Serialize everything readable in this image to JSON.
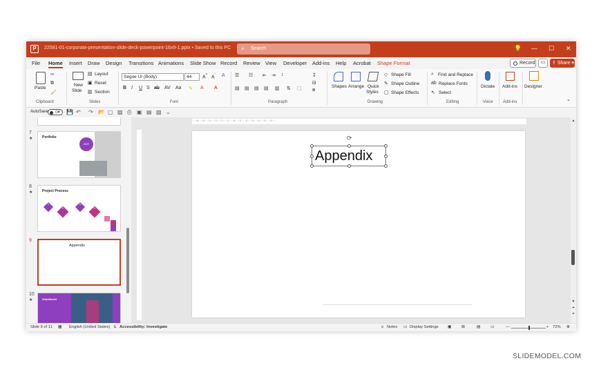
{
  "window": {
    "title": "22581-01-corporate-presentation-slide-deck-powerpoint-16x9-1.pptx • Saved to this PC",
    "search_placeholder": "Search"
  },
  "tabs": [
    "File",
    "Home",
    "Insert",
    "Draw",
    "Design",
    "Transitions",
    "Animations",
    "Slide Show",
    "Record",
    "Review",
    "View",
    "Developer",
    "Add-ins",
    "Help",
    "Acrobat",
    "Shape Format"
  ],
  "active_tab": "Home",
  "header_buttons": {
    "record": "Record",
    "share": "Share"
  },
  "ribbon": {
    "clipboard": {
      "paste": "Paste",
      "label": "Clipboard"
    },
    "slides": {
      "new_slide": "New",
      "new_slide2": "Slide",
      "layout": "Layout",
      "reset": "Reset",
      "section": "Section",
      "label": "Slides"
    },
    "font": {
      "family": "Segoe UI (Body)",
      "size": "44",
      "label": "Font"
    },
    "paragraph": {
      "label": "Paragraph"
    },
    "drawing": {
      "shapes": "Shapes",
      "arrange": "Arrange",
      "quick_styles": "Quick",
      "quick_styles2": "Styles",
      "fill": "Shape Fill",
      "outline": "Shape Outline",
      "effects": "Shape Effects",
      "label": "Drawing"
    },
    "editing": {
      "find": "Find and Replace",
      "replace": "Replace Fonts",
      "select": "Select",
      "label": "Editing"
    },
    "voice": {
      "dictate": "Dictate",
      "label": "Voice"
    },
    "addins": {
      "addins": "Add-ins",
      "label": "Add-ins"
    },
    "designer": {
      "designer": "Designer"
    }
  },
  "qat": {
    "autosave": "AutoSave",
    "toggle": "Off"
  },
  "thumbnails": [
    {
      "num": "7",
      "title": "Portfolio",
      "badge": "2027"
    },
    {
      "num": "8",
      "title": "Project Process",
      "steps": [
        "01",
        "02",
        "03",
        "04"
      ]
    },
    {
      "num": "9",
      "title": "Appendix"
    },
    {
      "num": "10",
      "title": "SlideModel"
    }
  ],
  "slide": {
    "title_text": "Appendix"
  },
  "status": {
    "slide": "Slide 9 of 11",
    "language": "English (United States)",
    "accessibility": "Accessibility: Investigate",
    "notes": "Notes",
    "display": "Display Settings",
    "zoom": "72%"
  },
  "watermark": "SLIDEMODEL.COM",
  "colors": {
    "accent": "#c43e1c",
    "thumb_purple": "#8e3fbf",
    "thumb_magenta": "#c2347a"
  }
}
